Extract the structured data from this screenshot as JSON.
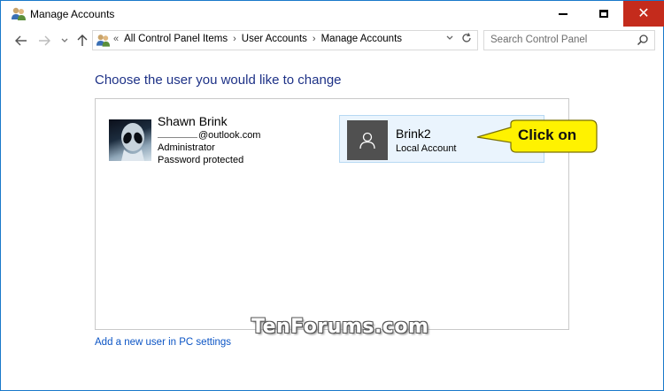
{
  "window": {
    "title": "Manage Accounts",
    "accent": "#1979ca",
    "close_color": "#c42b1c"
  },
  "navigation": {
    "lead": "«",
    "breadcrumbs": [
      "All Control Panel Items",
      "User Accounts",
      "Manage Accounts"
    ],
    "separator": "›",
    "search_placeholder": "Search Control Panel"
  },
  "main": {
    "heading": "Choose the user you would like to change",
    "accounts": [
      {
        "name": "Shawn Brink",
        "email_suffix": "@outlook.com",
        "role": "Administrator",
        "status": "Password protected",
        "avatar_icon": "alien-avatar-icon"
      },
      {
        "name": "Brink2",
        "type": "Local Account",
        "avatar_icon": "user-silhouette-icon"
      }
    ],
    "add_user_link": "Add a new user in PC settings"
  },
  "callout": {
    "text": "Click on",
    "fill": "#fff200"
  },
  "watermark": {
    "text": "TenForums.com"
  }
}
